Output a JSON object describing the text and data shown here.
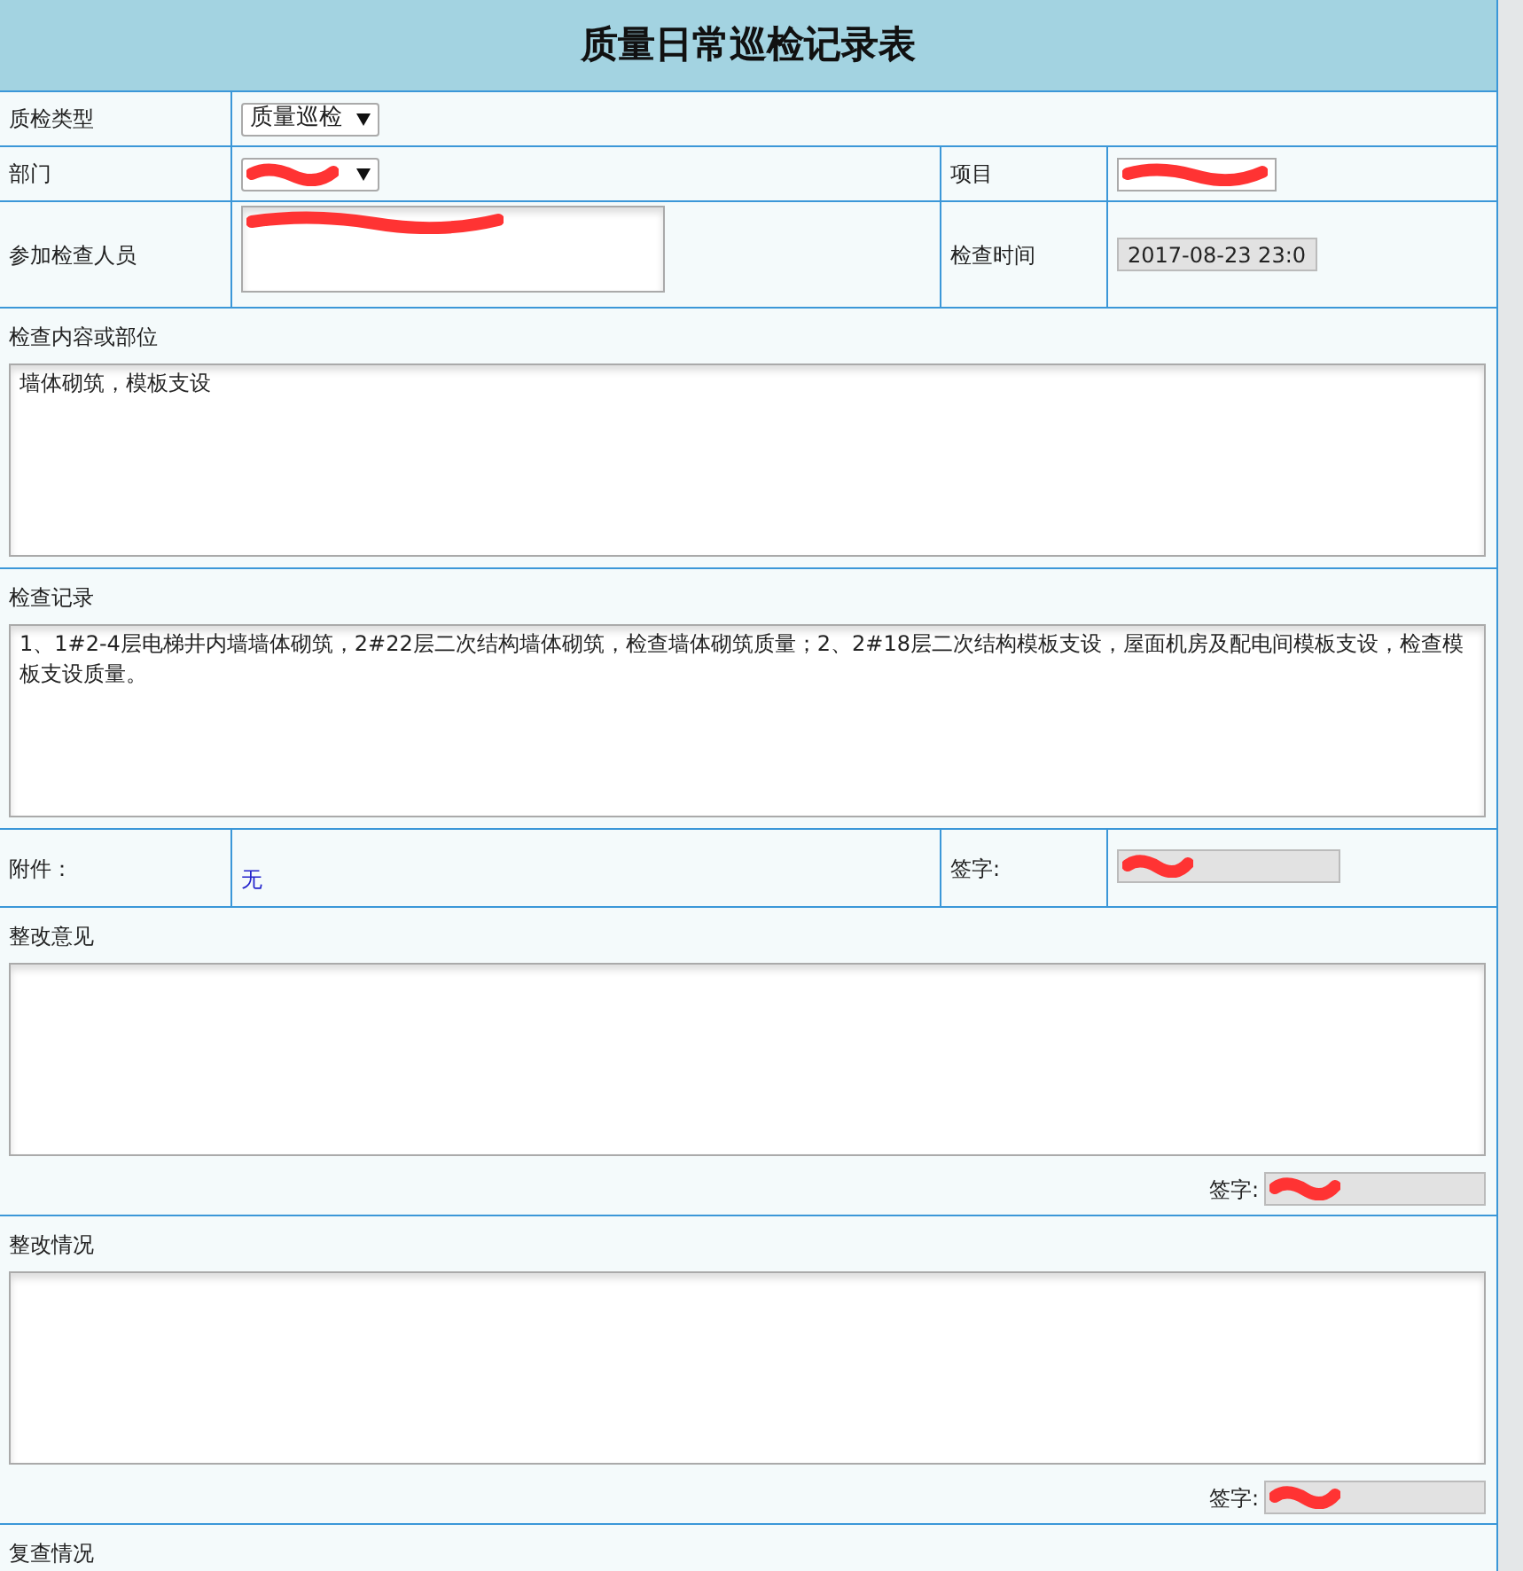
{
  "title": "质量日常巡检记录表",
  "inspection_type": {
    "label": "质检类型",
    "value": "质量巡检"
  },
  "department": {
    "label": "部门",
    "redacted": true
  },
  "project": {
    "label": "项目",
    "redacted": true
  },
  "participants": {
    "label": "参加检查人员",
    "redacted": true
  },
  "inspection_time": {
    "label": "检查时间",
    "value": "2017-08-23 23:0"
  },
  "sections": [
    {
      "kind": "textarea",
      "label": "检查内容或部位",
      "value": "墙体砌筑，模板支设"
    },
    {
      "kind": "textarea",
      "label": "检查记录",
      "value": "1、1#2-4层电梯井内墙墙体砌筑，2#22层二次结构墙体砌筑，检查墙体砌筑质量；2、2#18层二次结构模板支设，屋面机房及配电间模板支设，检查模板支设质量。"
    },
    {
      "kind": "attachment",
      "label": "附件：",
      "value": "无",
      "signature_label": "签字:",
      "signature_redacted": true
    },
    {
      "kind": "signed_textarea",
      "label": "整改意见",
      "signature_label": "签字:",
      "signature_redacted": true
    },
    {
      "kind": "signed_textarea",
      "label": "整改情况",
      "signature_label": "签字:",
      "signature_redacted": true
    },
    {
      "kind": "heading",
      "label": "复查情况"
    }
  ]
}
